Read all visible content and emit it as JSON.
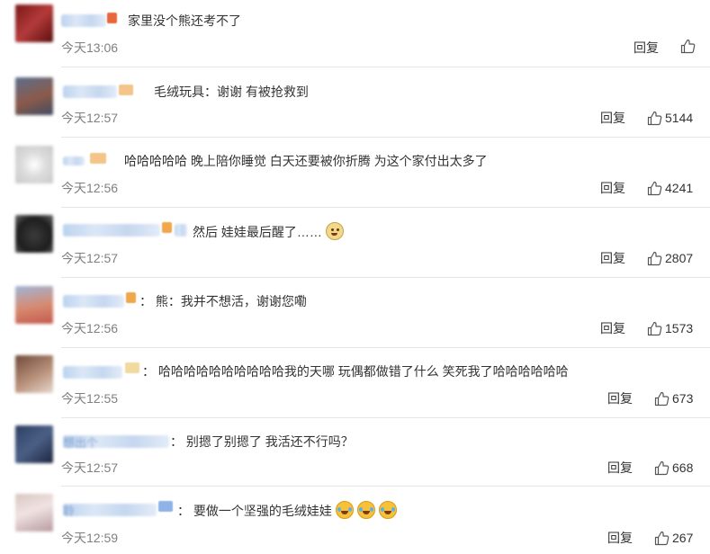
{
  "reply_label": "回复",
  "comments": [
    {
      "text": "家里没个熊还考不了",
      "time": "今天13:06",
      "likes": ""
    },
    {
      "text": "毛绒玩具：谢谢 有被抢救到",
      "time": "今天12:57",
      "likes": "5144"
    },
    {
      "text": "哈哈哈哈哈 晚上陪你睡觉 白天还要被你折腾 为这个家付出太多了",
      "time": "今天12:56",
      "likes": "4241"
    },
    {
      "text": "然后 娃娃最后醒了……",
      "time": "今天12:57",
      "likes": "2807"
    },
    {
      "text": "：  熊：我并不想活，谢谢您嘞",
      "time": "今天12:56",
      "likes": "1573"
    },
    {
      "text": "：  哈哈哈哈哈哈哈哈哈哈我的天哪 玩偶都做错了什么 笑死我了哈哈哈哈哈哈",
      "time": "今天12:55",
      "likes": "673"
    },
    {
      "text": "：  别摁了别摁了 我活还不行吗？",
      "time": "今天12:57",
      "likes": "668"
    },
    {
      "text": "：  要做一个坚强的毛绒娃娃",
      "time": "今天12:59",
      "likes": "267"
    }
  ],
  "name_fragments": {
    "c7": "想出个",
    "c8": "聆"
  },
  "colors": {
    "time": "#808080",
    "text": "#333333",
    "divider": "#e6e6e6",
    "name_blur": "#c9dbf1"
  }
}
